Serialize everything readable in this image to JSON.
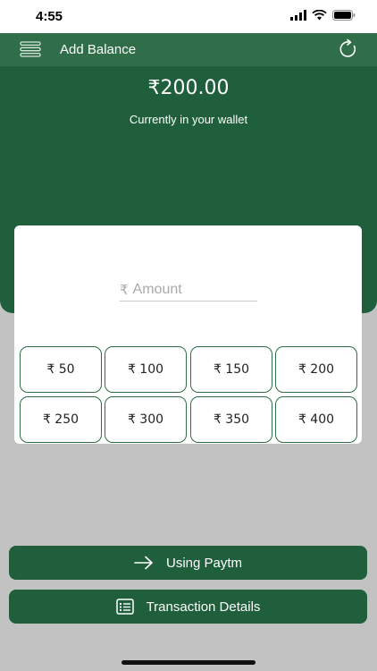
{
  "status_bar": {
    "time": "4:55"
  },
  "header": {
    "title": "Add Balance",
    "menu_icon": "hamburger-menu-icon",
    "refresh_icon": "refresh-icon"
  },
  "wallet": {
    "balance": "₹200.00",
    "caption": "Currently in your wallet"
  },
  "amount_input": {
    "currency_symbol": "₹",
    "placeholder": "Amount"
  },
  "quick_amounts": [
    "₹ 50",
    "₹ 100",
    "₹ 150",
    "₹ 200",
    "₹ 250",
    "₹ 300",
    "₹ 350",
    "₹ 400"
  ],
  "actions": {
    "paytm": {
      "label": "Using Paytm",
      "icon": "arrow-right-icon"
    },
    "transactions": {
      "label": "Transaction Details",
      "icon": "receipt-list-icon"
    }
  },
  "colors": {
    "header_green": "#2f6e48",
    "panel_green": "#1f5f3c",
    "background_gray": "#c2c2c2",
    "chip_border": "#2f6e48"
  }
}
